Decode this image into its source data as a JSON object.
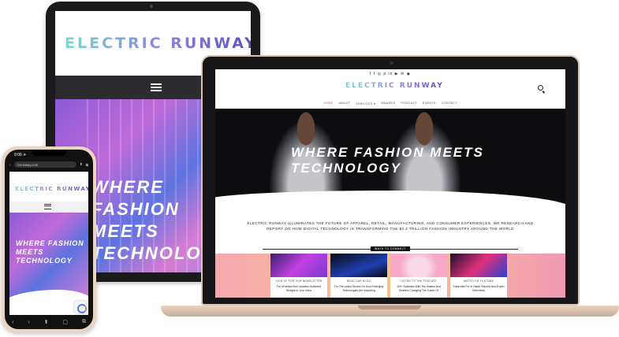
{
  "brand": {
    "logo_text": "ELECTRIC RUNWAY",
    "logo_colors": [
      "#7ad7d0",
      "#8b7fd6",
      "#5a4fc0"
    ]
  },
  "tablet": {
    "hero_title": "WHERE FASHION MEETS TECHNOLOGY"
  },
  "laptop": {
    "social_icons": [
      "facebook-icon",
      "twitter-icon",
      "instagram-icon",
      "pinterest-icon",
      "linkedin-icon",
      "youtube-icon",
      "email-icon",
      "rss-icon"
    ],
    "social_glyphs": "f t ◎ p in ▶ ✉ ◉",
    "nav": [
      "HOME",
      "ABOUT",
      "SERVICES ▾",
      "AWARDS",
      "PODCAST",
      "EVENTS",
      "CONTACT"
    ],
    "hero_title": "WHERE FASHION MEETS TECHNOLOGY",
    "mission": "ELECTRIC RUNWAY ILLUMINATES THE FUTURE OF APPAREL, RETAIL, MANUFACTURING, AND CONSUMER EXPERIENCES. WE RESEARCH AND REPORT ON HOW DIGITAL TECHNOLOGY IS TRANSFORMING THE $2.4 TRILLION FASHION INDUSTRY AROUND THE WORLD",
    "connect_label": "WAYS TO CONNECT",
    "cards": [
      {
        "title": "SIGN UP FOR OUR NEWSLETTER",
        "desc": "For #FashionTech Updates Delivered Straight to Your Inbox"
      },
      {
        "title": "READ OUR BLOG",
        "desc": "For The Latest Stories On How Emerging Technologies Are Impacting"
      },
      {
        "title": "LISTEN TO THE PODCAST",
        "desc": "100+ Episodes With The Makers And Shakers Changing The Future Of"
      },
      {
        "title": "WATCH ON YOUTUBE",
        "desc": "Subscribe For In Depth Reports And Expert Interviews"
      }
    ]
  },
  "phone": {
    "time": "9:06 ✈",
    "url": "ricrunway.com",
    "hero_title": "WHERE FASHION MEETS TECHNOLOGY",
    "bottom_glyphs": [
      "‹",
      "›",
      "⬆",
      "▢",
      "⧉"
    ]
  }
}
